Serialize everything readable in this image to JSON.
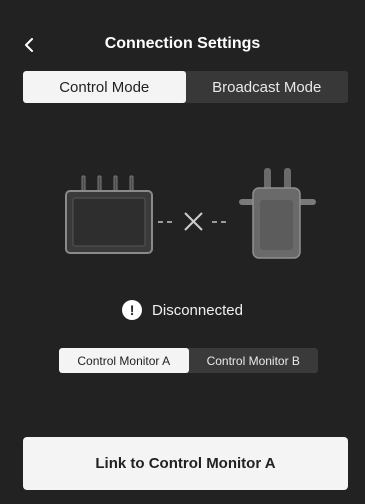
{
  "header": {
    "title": "Connection Settings",
    "back_icon": "chevron-left-icon"
  },
  "mode_tabs": {
    "items": [
      "Control Mode",
      "Broadcast Mode"
    ],
    "selected": "Control Mode"
  },
  "illustration": {
    "left_device": "monitor-icon",
    "right_device": "transmitter-icon",
    "link_state_icon": "disconnected-x-icon"
  },
  "status": {
    "icon": "exclamation-icon",
    "icon_glyph": "!",
    "text": "Disconnected"
  },
  "monitor_tabs": {
    "items": [
      "Control Monitor A",
      "Control Monitor B"
    ],
    "selected": "Control Monitor A"
  },
  "action": {
    "label": "Link to Control Monitor A"
  },
  "colors": {
    "background": "#222222",
    "active_segment": "#f4f4f4",
    "inactive_segment": "#383838"
  }
}
